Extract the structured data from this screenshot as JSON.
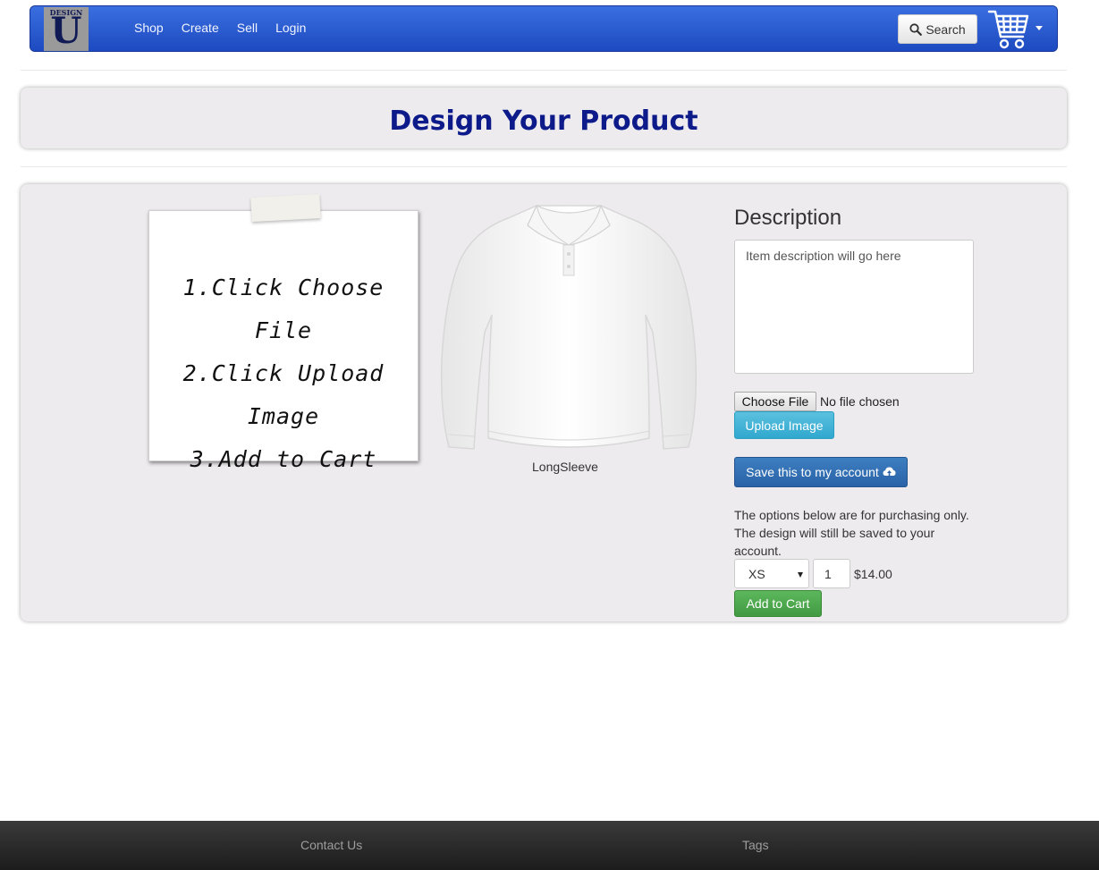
{
  "navbar": {
    "logo": {
      "top_text": "DESIGN",
      "letter": "U"
    },
    "links": [
      "Shop",
      "Create",
      "Sell",
      "Login"
    ],
    "search_label": "Search"
  },
  "page_title": "Design Your Product",
  "instructions": [
    "1.Click Choose File",
    "2.Click Upload",
    "Image",
    "3.Add to Cart"
  ],
  "product": {
    "name": "LongSleeve",
    "image": "white-long-sleeve-polo-shirt"
  },
  "description": {
    "heading": "Description",
    "placeholder": "Item description will go here"
  },
  "file_input": {
    "button_label": "Choose File",
    "status": "No file chosen"
  },
  "upload_label": "Upload Image",
  "save_label": "Save this to my account",
  "options_text": "The options below are for purchasing only. The design will still be saved to your account.",
  "purchase": {
    "size": "XS",
    "quantity": "1",
    "price": "$14.00",
    "add_label": "Add to Cart"
  },
  "footer": {
    "contact": "Contact Us",
    "tags": "Tags"
  },
  "colors": {
    "navbar": "#2b5bd6",
    "title": "#0c1a8a",
    "upload_button": "#5bc0de",
    "save_button": "#3472b4",
    "cart_button": "#5cb85c",
    "footer": "#222222"
  }
}
